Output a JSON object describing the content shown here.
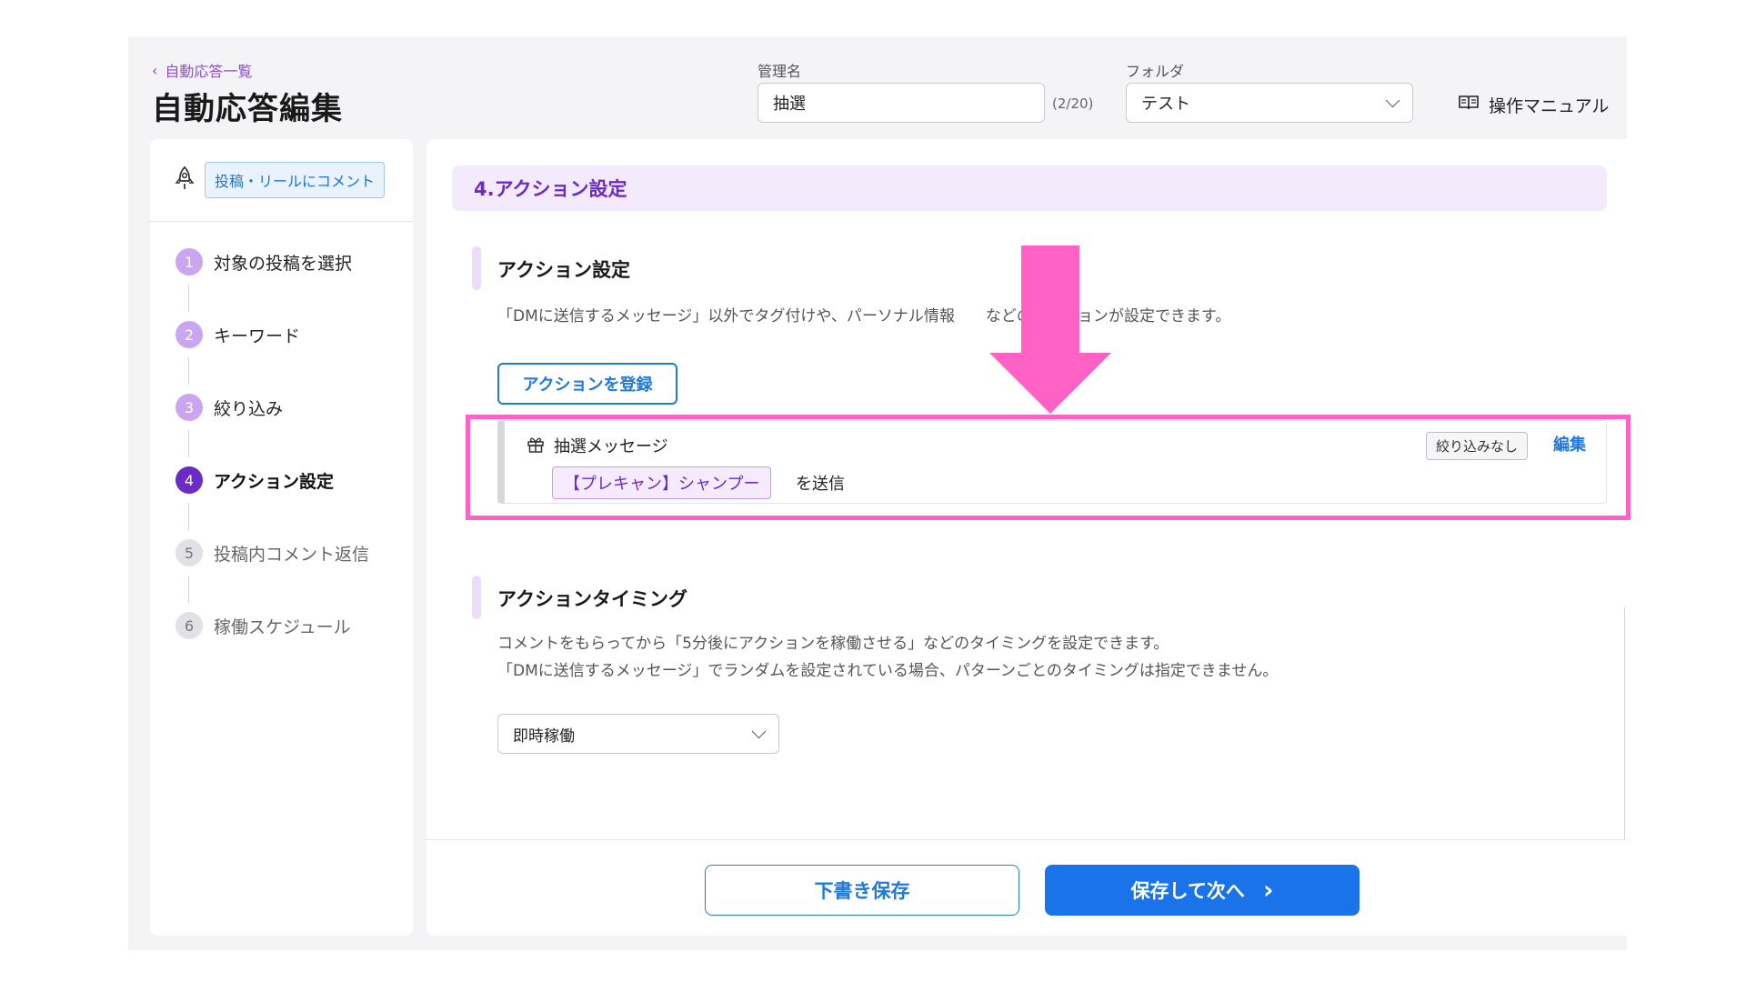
{
  "header": {
    "back_label": "自動応答一覧",
    "title": "自動応答編集",
    "name_label": "管理名",
    "name_value": "抽選",
    "name_counter": "(2/20)",
    "folder_label": "フォルダ",
    "folder_value": "テスト",
    "manual_label": "操作マニュアル"
  },
  "sidebar": {
    "type_badge": "投稿・リールにコメント",
    "steps": [
      {
        "num": "1",
        "label": "対象の投稿を選択",
        "state": "done"
      },
      {
        "num": "2",
        "label": "キーワード",
        "state": "done"
      },
      {
        "num": "3",
        "label": "絞り込み",
        "state": "done"
      },
      {
        "num": "4",
        "label": "アクション設定",
        "state": "active"
      },
      {
        "num": "5",
        "label": "投稿内コメント返信",
        "state": "todo"
      },
      {
        "num": "6",
        "label": "稼働スケジュール",
        "state": "todo"
      }
    ]
  },
  "main": {
    "section_title": "4.アクション設定",
    "action": {
      "title": "アクション設定",
      "description": "「DMに送信するメッセージ」以外でタグ付けや、パーソナル情報　　などのアクションが設定できます。",
      "register_button": "アクションを登録",
      "card": {
        "title": "抽選メッセージ",
        "tag": "【プレキャン】シャンプー",
        "send_suffix": "を送信",
        "filter_badge": "絞り込みなし",
        "edit_label": "編集"
      }
    },
    "timing": {
      "title": "アクションタイミング",
      "description_1": "コメントをもらってから「5分後にアクションを稼働させる」などのタイミングを設定できます。",
      "description_2": "「DMに送信するメッセージ」でランダムを設定されている場合、パターンごとのタイミングは指定できません。",
      "select_value": "即時稼働"
    },
    "footer": {
      "draft_button": "下書き保存",
      "next_button": "保存して次へ",
      "next_icon": "›"
    }
  },
  "colors": {
    "accent_purple": "#6a2bc7",
    "primary_blue": "#1a73e8",
    "annotation_pink": "#ff62c4"
  }
}
